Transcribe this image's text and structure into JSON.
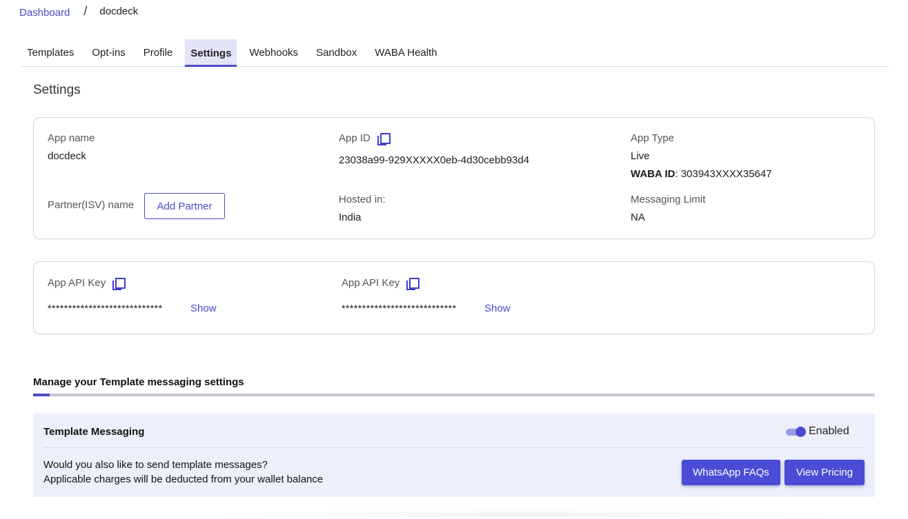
{
  "breadcrumb": {
    "home": "Dashboard",
    "separator": "/",
    "current": "docdeck"
  },
  "tabs": [
    {
      "label": "Templates",
      "active": false
    },
    {
      "label": "Opt-ins",
      "active": false
    },
    {
      "label": "Profile",
      "active": false
    },
    {
      "label": "Settings",
      "active": true
    },
    {
      "label": "Webhooks",
      "active": false
    },
    {
      "label": "Sandbox",
      "active": false
    },
    {
      "label": "WABA Health",
      "active": false
    }
  ],
  "settings": {
    "title": "Settings",
    "app_name_label": "App name",
    "app_name": "docdeck",
    "partner_label": "Partner(ISV) name",
    "add_partner_label": "Add Partner",
    "app_id_label": "App ID",
    "app_id": "23038a99-929XXXXX0eb-4d30cebb93d4",
    "hosted_label": "Hosted in:",
    "hosted_value": "India",
    "app_type_label": "App Type",
    "app_type": "Live",
    "waba_label": "WABA ID",
    "waba_value": ": 303943XXXX35647",
    "messaging_limit_label": "Messaging Limit",
    "messaging_limit": "NA"
  },
  "api_keys": [
    {
      "label": "App API Key",
      "masked": "****************************",
      "show_label": "Show"
    },
    {
      "label": "App API Key",
      "masked": "****************************",
      "show_label": "Show"
    }
  ],
  "template_settings": {
    "section_title": "Manage your Template messaging settings",
    "progress_fraction": 0.02,
    "panel_title": "Template Messaging",
    "toggle_state": "Enabled",
    "question": "Would you also like to send template messages?",
    "charges_note": "Applicable charges will be deducted from your wallet balance",
    "faq_button": "WhatsApp FAQs",
    "pricing_button": "View Pricing"
  },
  "colors": {
    "accent": "#4b4bc7",
    "panel_bg": "#edf0fa",
    "active_tab_bg": "#e4e4f7"
  },
  "icons": [
    "copy-icon"
  ]
}
